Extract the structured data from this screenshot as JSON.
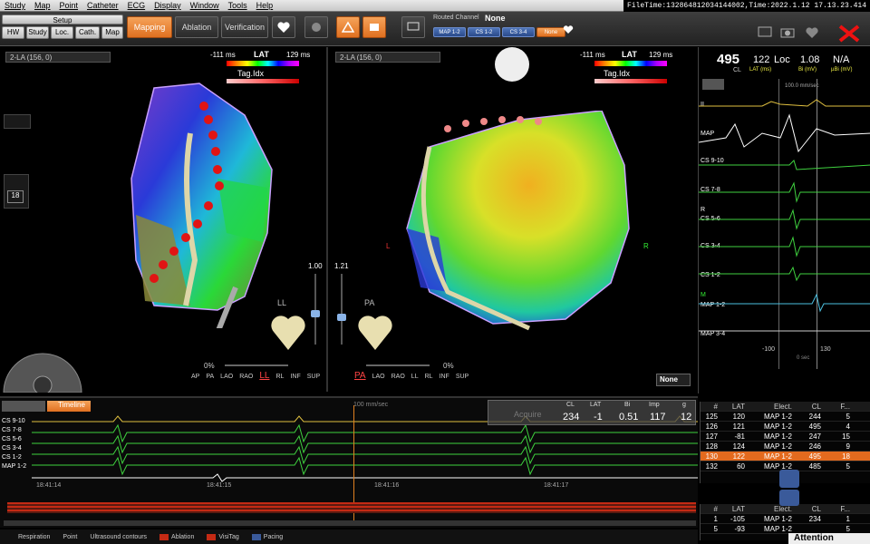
{
  "menu": [
    "Study",
    "Map",
    "Point",
    "Catheter",
    "ECG",
    "Display",
    "Window",
    "Tools",
    "Help"
  ],
  "file_time": "FileTime:132864812034144002,Time:2022.1.12 17.13.23.414",
  "toolbar": {
    "setup_label": "Setup",
    "setup_items": [
      "HW",
      "Study",
      "Loc.",
      "Cath.",
      "Map"
    ],
    "mapping": "Mapping",
    "ablation": "Ablation",
    "verification": "Verification",
    "routed_channel_label": "Routed Channel",
    "routed_channel_value": "None",
    "routed_buttons": [
      "MAP 1-2",
      "CS 1-2",
      "CS 3-4",
      "None"
    ]
  },
  "left_view": {
    "header": "2-LA (156, 0)",
    "lat_min": "-111 ms",
    "lat_label": "LAT",
    "lat_max": "129 ms",
    "tag_label": "Tag.Idx",
    "slider_val": "1.00",
    "orient": "LL",
    "zoom": "0%",
    "buttons": [
      "AP",
      "PA",
      "LAO",
      "RAO",
      "LL",
      "RL",
      "INF",
      "SUP"
    ],
    "active": "LL",
    "side_count": "18"
  },
  "right_view": {
    "header": "2-LA (156, 0)",
    "lat_min": "-111 ms",
    "lat_label": "LAT",
    "lat_max": "129 ms",
    "tag_label": "Tag.Idx",
    "slider_val": "1.21",
    "orient": "PA",
    "zoom": "0%",
    "buttons": [
      "PA",
      "LAO",
      "RAO",
      "LL",
      "RL",
      "INF",
      "SUP"
    ],
    "active": "PA",
    "none_select": "None",
    "marker_l": "L",
    "marker_r": "R"
  },
  "readout": {
    "cl": "495",
    "cl_label": "CL",
    "loc": "122",
    "loc_label": "Loc",
    "lat_unit": "LAT (ms)",
    "bi": "1.08",
    "bi_unit": "Bi (mV)",
    "na": "N/A",
    "ubi_unit": "µBi (mV)"
  },
  "ecg_right": {
    "channels": [
      "II",
      "MAP",
      "CS 9-10",
      "CS 7-8",
      "CS 5-6",
      "CS 3-4",
      "CS 1-2",
      "MAP 1-2",
      "MAP 3-4"
    ],
    "speed": "100.0 mm/sec",
    "tick_left": "-100",
    "tick_right": "130",
    "zero": "0 sec",
    "marker_r": "R",
    "marker_m": "M"
  },
  "timeline": {
    "title": "Timeline",
    "channels": [
      "CS 9-10",
      "CS 7-8",
      "CS 5-6",
      "CS 3-4",
      "CS 1-2",
      "MAP 1-2"
    ],
    "times": [
      "18:41:14",
      "18:41:15",
      "18:41:16",
      "18:41:17"
    ],
    "speed": "100 mm/sec",
    "acquire": "Acquire",
    "stats_headers": [
      "CL",
      "LAT",
      "Bi",
      "Imp",
      "g"
    ],
    "stats_values": [
      "234",
      "-1",
      "0.51",
      "117",
      "12"
    ]
  },
  "points_table": {
    "headers": [
      "#",
      "LAT",
      "Elect.",
      "CL",
      "F..."
    ],
    "rows": [
      [
        "125",
        "120",
        "MAP 1-2",
        "244",
        "5"
      ],
      [
        "126",
        "121",
        "MAP 1-2",
        "495",
        "4"
      ],
      [
        "127",
        "-81",
        "MAP 1-2",
        "247",
        "15"
      ],
      [
        "128",
        "124",
        "MAP 1-2",
        "246",
        "9"
      ],
      [
        "130",
        "122",
        "MAP 1-2",
        "495",
        "18"
      ],
      [
        "132",
        "60",
        "MAP 1-2",
        "485",
        "5"
      ]
    ],
    "selected_index": 4
  },
  "lower_table": {
    "headers": [
      "#",
      "LAT",
      "Elect.",
      "CL",
      "F..."
    ],
    "rows": [
      [
        "1",
        "-105",
        "MAP 1-2",
        "234",
        "1"
      ],
      [
        "5",
        "-93",
        "MAP 1-2",
        "",
        "5"
      ]
    ]
  },
  "legend": [
    "Respiration",
    "Point",
    "Ultrasound contours",
    "Ablation",
    "VisiTag",
    "Pacing"
  ],
  "attention": "Attention",
  "colors": {
    "accent": "#e07020",
    "selected_row": "#e36a1e",
    "ecg_green": "#3fd13f"
  }
}
